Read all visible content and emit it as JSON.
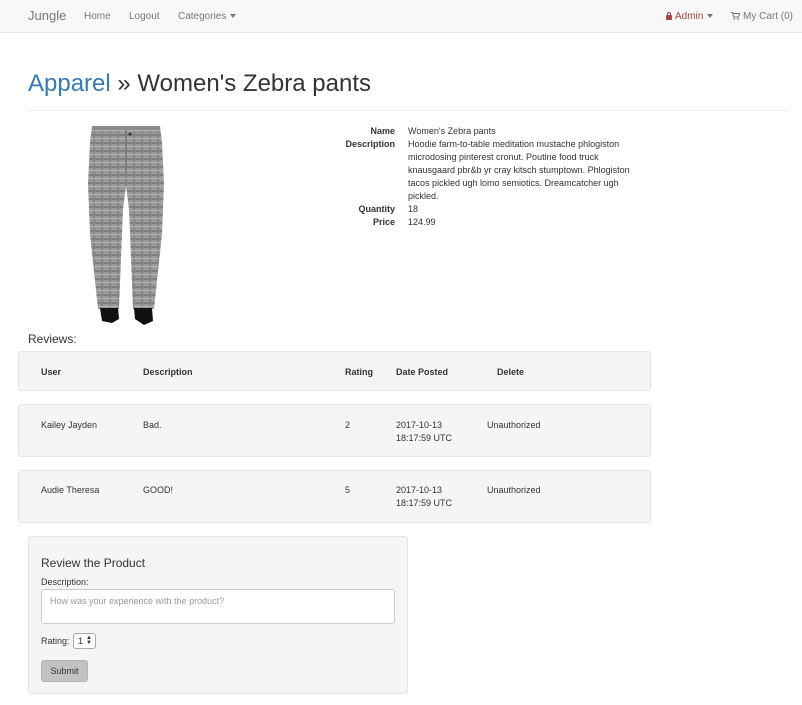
{
  "navbar": {
    "brand": "Jungle",
    "links": [
      "Home",
      "Logout",
      "Categories"
    ],
    "admin": "Admin",
    "cart": "My Cart (0)"
  },
  "heading": {
    "category": "Apparel",
    "separator": " » ",
    "product": "Women's Zebra pants"
  },
  "product": {
    "image_alt": "Women's Zebra pants",
    "details": {
      "name_label": "Name",
      "name": "Women's Zebra pants",
      "description_label": "Description",
      "description_lines": [
        "Hoodie farm-to-table meditation mustache phlogiston",
        "microdosing pinterest cronut. Poutine food truck",
        "knausgaard pbr&b yr cray kitsch stumptown. Phlogiston",
        "tacos pickled ugh lomo semiotics. Dreamcatcher ugh",
        "pickled."
      ],
      "quantity_label": "Quantity",
      "quantity": "18",
      "price_label": "Price",
      "price": "124.99"
    }
  },
  "reviews": {
    "title": "Reviews:",
    "columns": [
      "User",
      "Description",
      "Rating",
      "Date Posted",
      "Delete"
    ],
    "rows": [
      {
        "user": "Kailey Jayden",
        "description": "Bad.",
        "rating": "2",
        "date": "2017-10-13",
        "time": "18:17:59 UTC",
        "delete": "Unauthorized"
      },
      {
        "user": "Audie Theresa",
        "description": "GOOD!",
        "rating": "5",
        "date": "2017-10-13",
        "time": "18:17:59 UTC",
        "delete": "Unauthorized"
      }
    ]
  },
  "review_form": {
    "title": "Review the Product",
    "description_label": "Description:",
    "description_placeholder": "How was your experience with the product?",
    "rating_label": "Rating:",
    "rating_value": "1",
    "submit": "Submit"
  },
  "colors": {
    "link": "#337ab7",
    "admin": "#a94442",
    "panel": "#f5f5f5"
  }
}
